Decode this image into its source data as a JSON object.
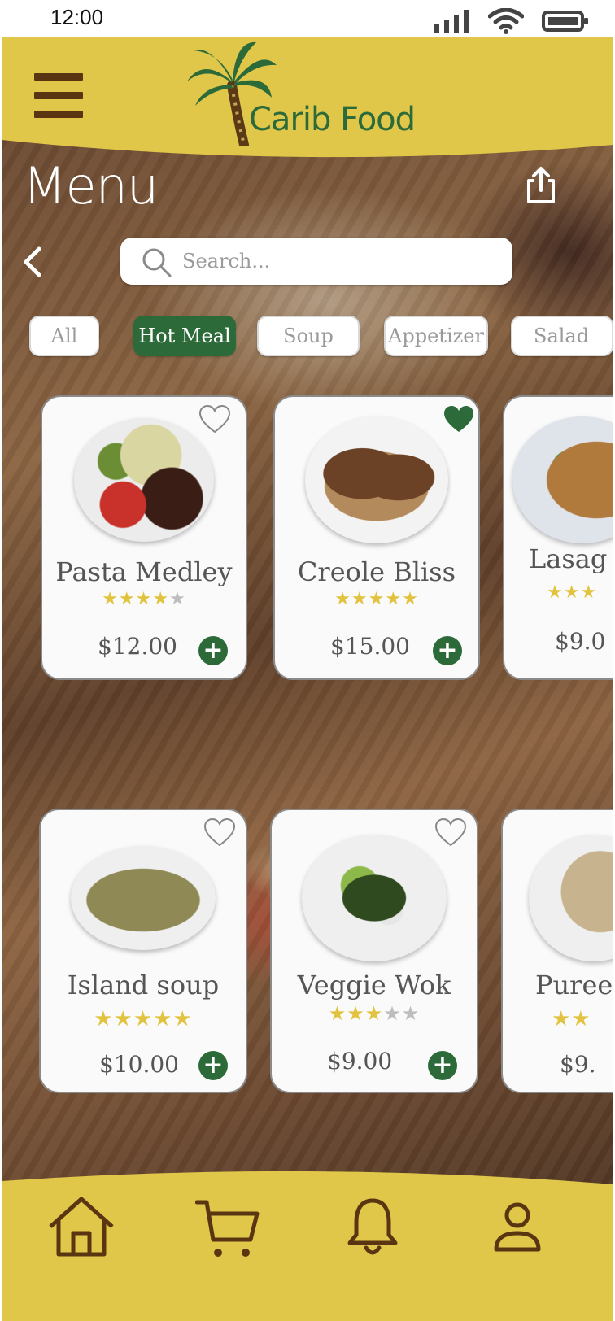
{
  "status_bar": {
    "time": "12:00"
  },
  "header": {
    "brand": "Carib Food"
  },
  "page": {
    "title": "Menu"
  },
  "search": {
    "placeholder": "Search..."
  },
  "categories": [
    {
      "label": "All",
      "active": false
    },
    {
      "label": "Hot Meal",
      "active": true
    },
    {
      "label": "Soup",
      "active": false
    },
    {
      "label": "Appetizer",
      "active": false
    },
    {
      "label": "Salad",
      "active": false
    }
  ],
  "menu_items": [
    {
      "name": "Pasta Medley",
      "rating": 4,
      "price": "$12.00",
      "favorite": false
    },
    {
      "name": "Creole Bliss",
      "rating": 5,
      "price": "$15.00",
      "favorite": true
    },
    {
      "name": "Lasag",
      "rating": 3,
      "price": "$9.0",
      "favorite": false
    },
    {
      "name": "Island soup",
      "rating": 5,
      "price": "$10.00",
      "favorite": false
    },
    {
      "name": "Veggie Wok",
      "rating": 3,
      "price": "$9.00",
      "favorite": false
    },
    {
      "name": "Puree",
      "rating": 2,
      "price": "$9.",
      "favorite": false
    }
  ],
  "colors": {
    "accent": "#e0c74a",
    "brand_green": "#2c6a3a",
    "brown": "#5a3512"
  },
  "icons": {
    "nav": [
      "home-icon",
      "cart-icon",
      "bell-icon",
      "profile-icon"
    ]
  }
}
